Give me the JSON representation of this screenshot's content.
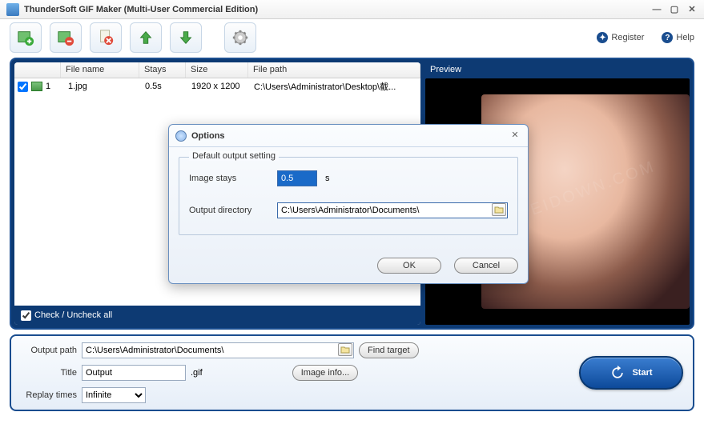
{
  "app": {
    "title": "ThunderSoft GIF Maker (Multi-User Commercial Edition)"
  },
  "links": {
    "register": "Register",
    "help": "Help"
  },
  "cols": {
    "chk_w": "58",
    "name": "File name",
    "name_w": "98",
    "stays": "Stays",
    "stays_w": "58",
    "size": "Size",
    "size_w": "78",
    "path": "File path"
  },
  "rows": [
    {
      "num": "1",
      "name": "1.jpg",
      "stays": "0.5s",
      "size": "1920 x 1200",
      "path": "C:\\Users\\Administrator\\Desktop\\截..."
    }
  ],
  "checkall": "Check / Uncheck all",
  "preview_label": "Preview",
  "bottom": {
    "output_path_lbl": "Output path",
    "output_path": "C:\\Users\\Administrator\\Documents\\",
    "find_target": "Find target",
    "title_lbl": "Title",
    "title_val": "Output",
    "gif_ext": ".gif",
    "image_info": "Image info...",
    "replay_lbl": "Replay times",
    "replay_val": "Infinite",
    "start": "Start"
  },
  "dialog": {
    "title": "Options",
    "legend": "Default output setting",
    "image_stays_lbl": "Image stays",
    "image_stays_val": "0.5",
    "seconds": "s",
    "outdir_lbl": "Output directory",
    "outdir_val": "C:\\Users\\Administrator\\Documents\\",
    "ok": "OK",
    "cancel": "Cancel"
  }
}
